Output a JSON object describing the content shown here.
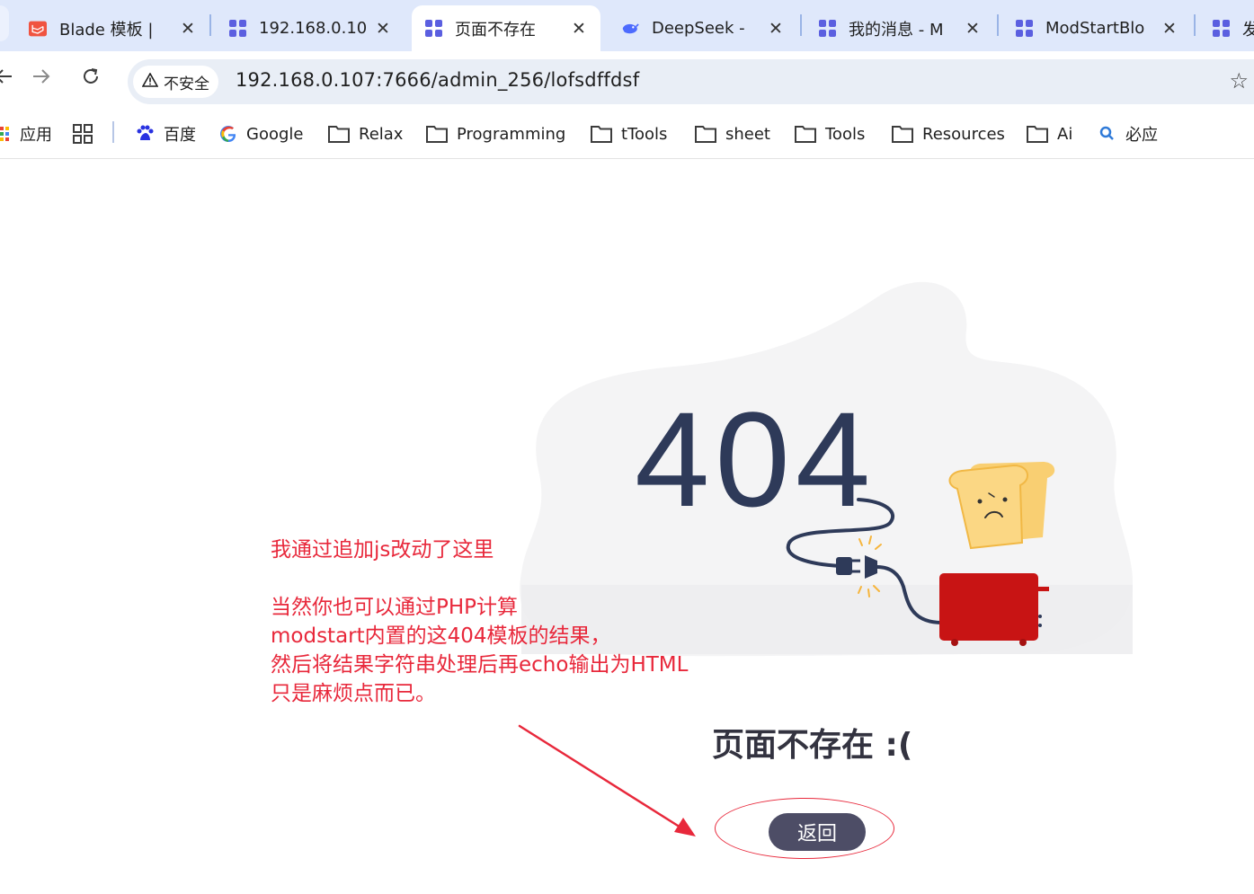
{
  "browser": {
    "tabs": [
      {
        "title": "Blade 模板 | ",
        "icon": "laravel-icon",
        "active": false
      },
      {
        "title": "192.168.0.10",
        "icon": "grid-icon",
        "active": false
      },
      {
        "title": "页面不存在",
        "icon": "grid-icon",
        "active": true
      },
      {
        "title": "DeepSeek - ",
        "icon": "deepseek-icon",
        "active": false
      },
      {
        "title": "我的消息 - M",
        "icon": "grid-icon",
        "active": false
      },
      {
        "title": "ModStartBlo",
        "icon": "grid-icon",
        "active": false
      },
      {
        "title": "发",
        "icon": "grid-icon",
        "active": false
      }
    ],
    "close_glyph": "✕",
    "security_label": "不安全",
    "url": "192.168.0.107:7666/admin_256/lofsdffdsf",
    "bookmarks": [
      {
        "label": "应用",
        "icon": "apps-icon"
      },
      {
        "label": "",
        "icon": "grid-icon"
      },
      {
        "label": "百度",
        "icon": "baidu-icon"
      },
      {
        "label": "Google",
        "icon": "google-icon"
      },
      {
        "label": "Relax",
        "icon": "folder-icon"
      },
      {
        "label": "Programming",
        "icon": "folder-icon"
      },
      {
        "label": "tTools",
        "icon": "folder-icon"
      },
      {
        "label": "sheet",
        "icon": "folder-icon"
      },
      {
        "label": "Tools",
        "icon": "folder-icon"
      },
      {
        "label": "Resources",
        "icon": "folder-icon"
      },
      {
        "label": "Ai",
        "icon": "folder-icon"
      },
      {
        "label": "必应",
        "icon": "bing-search-icon"
      }
    ]
  },
  "page": {
    "error_code": "404",
    "title": "页面不存在 :(",
    "back_button": "返回",
    "annotation": {
      "line1": "我通过追加js改动了这里",
      "line2": "当然你也可以通过PHP计算",
      "line3": "modstart内置的这404模板的结果，",
      "line4": "然后将结果字符串处理后再echo输出为HTML",
      "line5": "只是麻烦点而已。"
    }
  },
  "colors": {
    "tabstrip_bg": "#dfe8fb",
    "accent_red": "#e8283b",
    "code_color": "#2e3a59",
    "button_bg": "#4d4d66",
    "toaster_red": "#c81414",
    "toast_yellow": "#fcd581"
  }
}
